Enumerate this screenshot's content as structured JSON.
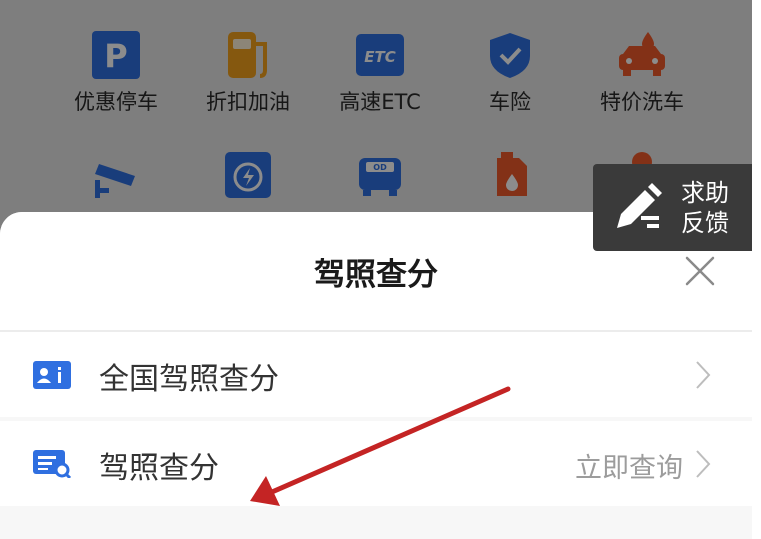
{
  "services": [
    {
      "label": "优惠停车",
      "icon": "parking-icon",
      "color": "#2f6fe0"
    },
    {
      "label": "折扣加油",
      "icon": "gas-pump-icon",
      "color": "#f2a11c"
    },
    {
      "label": "高速ETC",
      "icon": "etc-icon",
      "color": "#2f6fe0",
      "glyph": "ETC"
    },
    {
      "label": "车险",
      "icon": "shield-check-icon",
      "color": "#2f6fe0"
    },
    {
      "label": "特价洗车",
      "icon": "car-wash-icon",
      "color": "#ef5a2b"
    }
  ],
  "services_row2_icons": [
    {
      "icon": "camera-icon",
      "color": "#2f6fe0"
    },
    {
      "icon": "ev-charging-icon",
      "color": "#2f6fe0"
    },
    {
      "icon": "bus-icon",
      "color": "#2f6fe0",
      "glyph": "OD"
    },
    {
      "icon": "oil-can-icon",
      "color": "#ef5a2b"
    },
    {
      "icon": "person-icon",
      "color": "#ef5a2b"
    }
  ],
  "feedback": {
    "line1": "求助",
    "line2": "反馈"
  },
  "sheet": {
    "title": "驾照查分",
    "items": [
      {
        "label": "全国驾照查分",
        "icon": "id-card-icon",
        "action": ""
      },
      {
        "label": "驾照查分",
        "icon": "document-search-icon",
        "action": "立即查询"
      }
    ]
  },
  "colors": {
    "accent": "#2f6fe0",
    "arrow": "#c42424"
  }
}
